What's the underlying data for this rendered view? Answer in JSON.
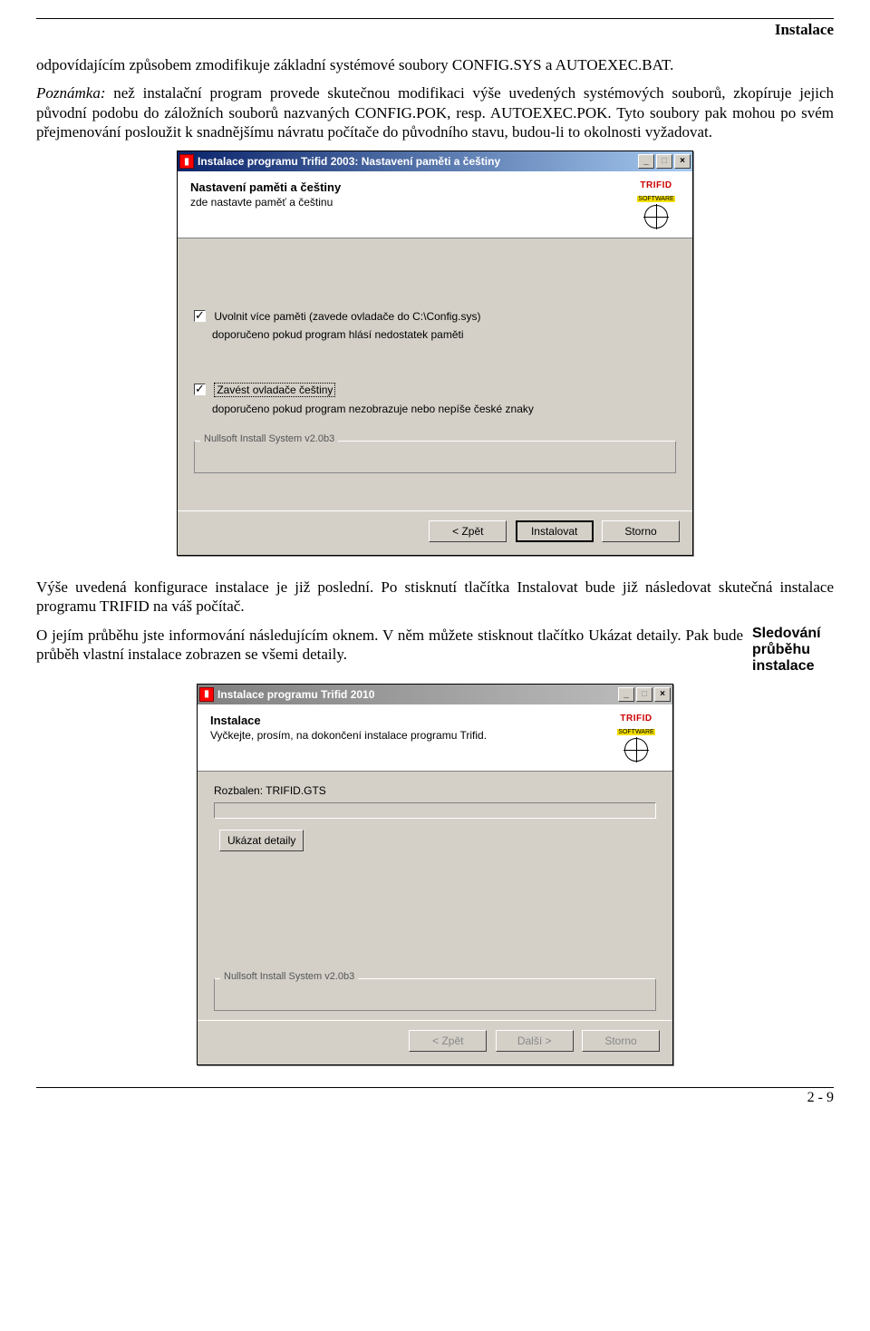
{
  "header": {
    "section": "Instalace"
  },
  "para1": "odpovídajícím způsobem zmodifikuje základní systémové soubory CONFIG.SYS a AUTOEXEC.BAT.",
  "para2_lead": "Poznámka:",
  "para2_rest": " než instalační program provede skutečnou modifikaci výše uvedených systémových souborů, zkopíruje jejich původní podobu do záložních souborů nazvaných CONFIG.POK, resp. AUTOEXEC.POK. Tyto soubory pak mohou po svém přejmenování posloužit k snadnějšímu návratu počítače do původního stavu, budou-li to okolnosti vyžadovat.",
  "dlg1": {
    "title": "Instalace programu Trifid 2003: Nastavení paměti a češtiny",
    "winbtns": {
      "min": "_",
      "max": "□",
      "close": "×"
    },
    "heading": "Nastavení paměti a češtiny",
    "subheading": "zde nastavte paměť a češtinu",
    "logo": {
      "brand": "TRIFID",
      "sub": "SOFTWARE"
    },
    "chk1": "Uvolnit více paměti (zavede ovladače do C:\\Config.sys)",
    "chk1_note": "doporučeno pokud program hlásí nedostatek paměti",
    "chk2": "Zavést ovladače češtiny",
    "chk2_note": "doporučeno pokud program nezobrazuje nebo nepíše české znaky",
    "group_legend": "Nullsoft Install System v2.0b3",
    "btn_back": "< Zpět",
    "btn_install": "Instalovat",
    "btn_cancel": "Storno"
  },
  "para3": "Výše uvedená konfigurace instalace je již poslední. Po stisknutí tlačítka Instalovat bude již následovat skutečná instalace programu TRIFID na váš počítač.",
  "para4": "O jejím průběhu jste informování následujícím oknem. V něm můžete stisknout tlačítko Ukázat detaily. Pak bude průběh vlastní instalace zobrazen se všemi detaily.",
  "side": {
    "line1": "Sledování",
    "line2": "průběhu",
    "line3": "instalace"
  },
  "dlg2": {
    "title": "Instalace programu Trifid 2010",
    "winbtns": {
      "min": "_",
      "max": "□",
      "close": "×"
    },
    "heading": "Instalace",
    "subheading": "Vyčkejte, prosím, na dokončení instalace programu Trifid.",
    "logo": {
      "brand": "TRIFID",
      "sub": "SOFTWARE"
    },
    "progress_label": "Rozbalen: TRIFID.GTS",
    "btn_details": "Ukázat detaily",
    "group_legend": "Nullsoft Install System v2.0b3",
    "btn_back": "< Zpět",
    "btn_next": "Další >",
    "btn_cancel": "Storno"
  },
  "footer": {
    "page": "2 - 9"
  }
}
